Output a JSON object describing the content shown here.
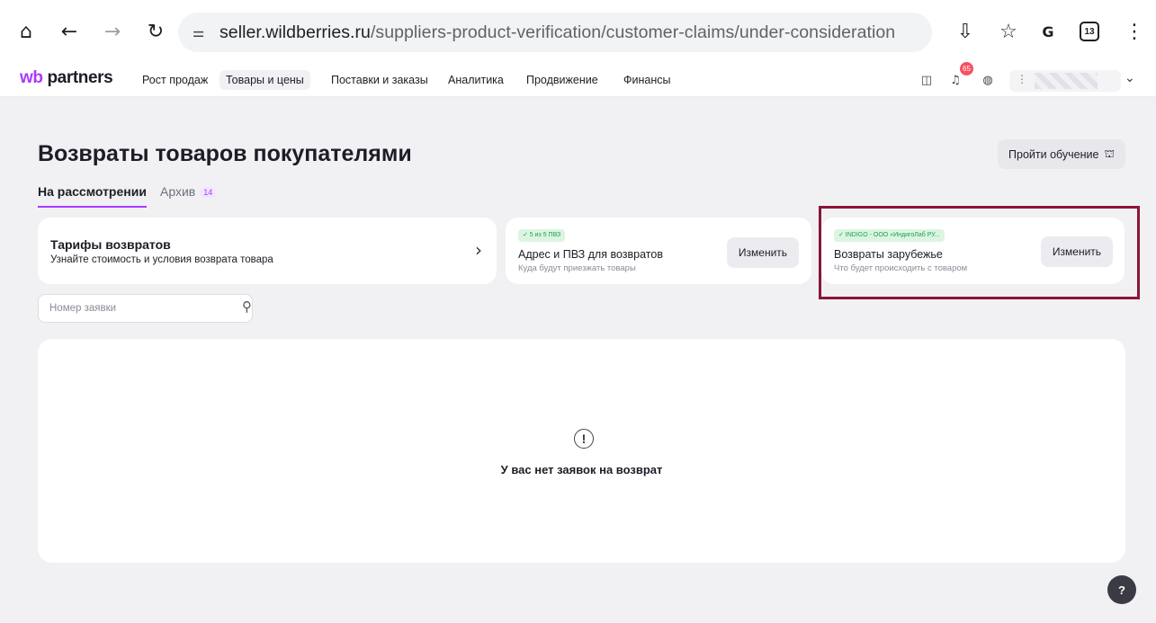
{
  "browser": {
    "url_host": "seller.wildberries.ru",
    "url_path": "/suppliers-product-verification/customer-claims/under-consideration",
    "tab_count": "13",
    "icons": [
      "home-icon",
      "back-icon",
      "forward-icon",
      "reload-icon",
      "site-settings-icon",
      "install-app-icon",
      "bookmark-star-icon",
      "translate-icon",
      "tab-count-icon",
      "menu-kebab-icon"
    ]
  },
  "header": {
    "logo_wb": "wb",
    "logo_rest": " partners",
    "nav": [
      "Рост продаж",
      "Товары и цены",
      "Поставки и заказы",
      "Аналитика",
      "Продвижение",
      "Финансы"
    ],
    "active_nav_index": 1,
    "notification_count": "65",
    "icons": [
      "chat-icon",
      "bell-icon",
      "support-icon",
      "chevron-down-icon"
    ]
  },
  "page": {
    "title": "Возвраты товаров покупателями",
    "training_button": "Пройти обучение",
    "tabs": {
      "active": "На рассмотрении",
      "archive": "Архив",
      "archive_count": "14"
    },
    "tariff_card": {
      "title": "Тарифы возвратов",
      "subtitle": "Узнайте стоимость и условия возврата товара"
    },
    "address_card": {
      "status": "✓ 5 из 5 ПВЗ",
      "title": "Адрес и ПВЗ для возвратов",
      "subtitle": "Куда будут приезжать товары",
      "button": "Изменить"
    },
    "foreign_card": {
      "status": "✓ INDIGO - ООО «ИндигоЛаб РУ...",
      "title": "Возвраты зарубежье",
      "subtitle": "Что будет происходить с товаром",
      "button": "Изменить"
    },
    "search": {
      "placeholder": "Номер заявки",
      "value": ""
    },
    "empty_state": {
      "text": "У вас нет заявок на возврат"
    },
    "help_button": "?"
  },
  "colors": {
    "brand": "#a73afd",
    "highlight_border": "#8c1538",
    "status_green": "#1aa14b",
    "badge_red": "#f5515f"
  }
}
